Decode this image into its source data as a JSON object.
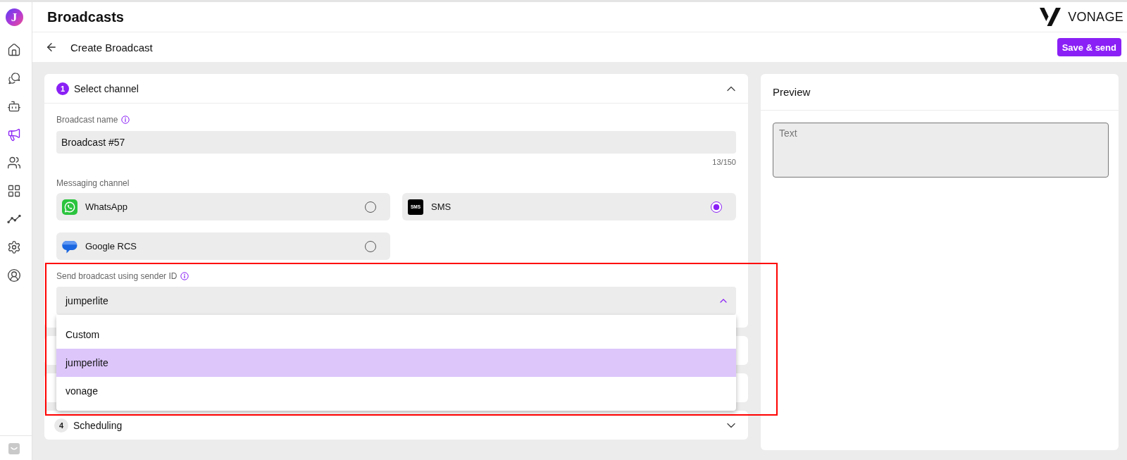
{
  "sidebar": {
    "logo": "J",
    "items": [
      {
        "selected": false
      },
      {
        "selected": false
      },
      {
        "selected": false
      },
      {
        "selected": true
      },
      {
        "selected": false
      },
      {
        "selected": false
      },
      {
        "selected": false
      },
      {
        "selected": false
      },
      {
        "selected": false
      }
    ]
  },
  "header": {
    "title": "Broadcasts",
    "brand": "VONAGE"
  },
  "subheader": {
    "title": "Create Broadcast",
    "button": "Save & send"
  },
  "steps": [
    {
      "number": "1",
      "title": "Select channel",
      "expanded": true,
      "content": {
        "broadcast_name": {
          "label": "Broadcast name",
          "info_icon": true,
          "value": "Broadcast #57",
          "counter": "13/150"
        },
        "messaging_channel": {
          "label": "Messaging channel",
          "options": [
            {
              "kind": "whatsapp",
              "label": "WhatsApp",
              "selected": false
            },
            {
              "kind": "sms",
              "label": "SMS",
              "logo_text": "SMS",
              "selected": true
            },
            {
              "kind": "rcs",
              "label": "Google RCS",
              "selected": false
            }
          ]
        },
        "sender_id": {
          "label": "Send broadcast using sender ID",
          "info_icon": true,
          "highlighted": true,
          "value": "jumperlite",
          "expanded": true,
          "options": [
            {
              "label": "Custom",
              "selected": false
            },
            {
              "label": "jumperlite",
              "selected": true
            },
            {
              "label": "vonage",
              "selected": false
            }
          ]
        }
      }
    },
    {
      "expanded": false
    },
    {
      "expanded": false
    },
    {
      "number": "4",
      "title": "Scheduling",
      "expanded": false
    }
  ],
  "preview": {
    "title": "Preview",
    "placeholder": "Text"
  }
}
